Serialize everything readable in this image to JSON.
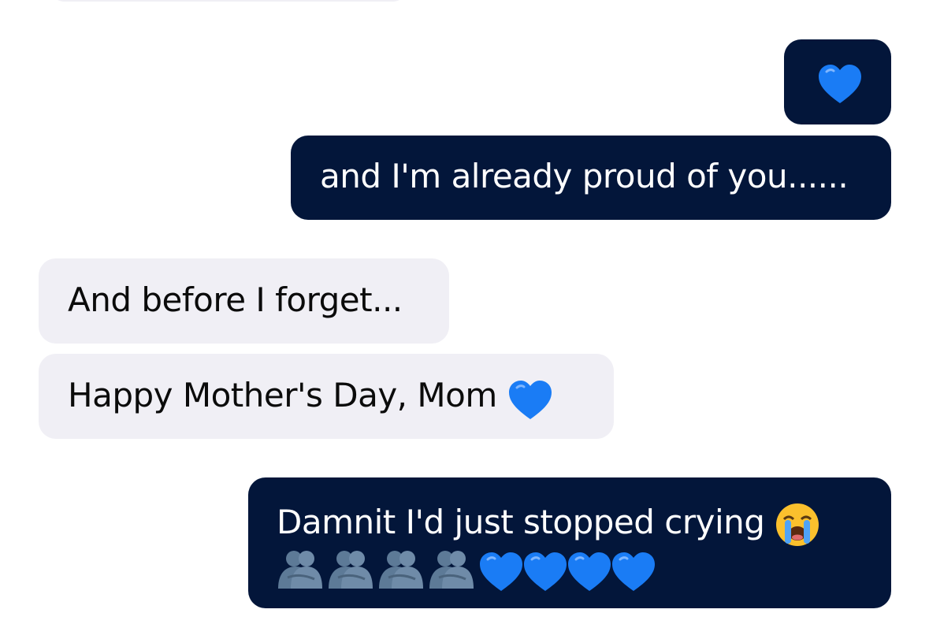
{
  "messages": [
    {
      "id": "m1",
      "direction": "sent",
      "text": "",
      "emoji": [
        "blue-heart"
      ]
    },
    {
      "id": "m2",
      "direction": "sent",
      "text": "and I'm already proud of you......"
    },
    {
      "id": "m3",
      "direction": "received",
      "text": "And before I forget..."
    },
    {
      "id": "m4",
      "direction": "received",
      "text": "Happy Mother's Day, Mom",
      "emoji": [
        "blue-heart"
      ]
    },
    {
      "id": "m5",
      "direction": "sent",
      "text": "Damnit I'd just stopped crying",
      "emoji": [
        "loudly-crying-face",
        "people-hugging",
        "people-hugging",
        "people-hugging",
        "people-hugging",
        "blue-heart",
        "blue-heart",
        "blue-heart",
        "blue-heart"
      ]
    }
  ],
  "colors": {
    "sent_bubble": "#03163a",
    "received_bubble": "#f0eff5",
    "heart": "#1a7cf5"
  }
}
